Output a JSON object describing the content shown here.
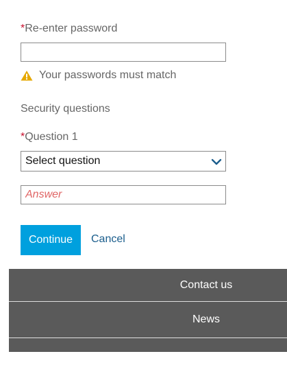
{
  "password_confirm": {
    "required_mark": "*",
    "label": "Re-enter password",
    "value": ""
  },
  "warning": {
    "icon": "warning-icon",
    "color": "#e6a800",
    "text": "Your passwords must match"
  },
  "security": {
    "heading": "Security questions",
    "question1": {
      "required_mark": "*",
      "label": "Question 1",
      "selected": "Select question",
      "icon": "chevron-down-icon"
    },
    "answer_placeholder": "Answer"
  },
  "actions": {
    "continue_label": "Continue",
    "cancel_label": "Cancel"
  },
  "footer": {
    "items": [
      {
        "label": "Contact us"
      },
      {
        "label": "News"
      }
    ]
  },
  "colors": {
    "primary_button": "#00a0de",
    "link": "#1a5d8c",
    "required": "#c8102e",
    "footer_bg": "#5a5a5a"
  }
}
